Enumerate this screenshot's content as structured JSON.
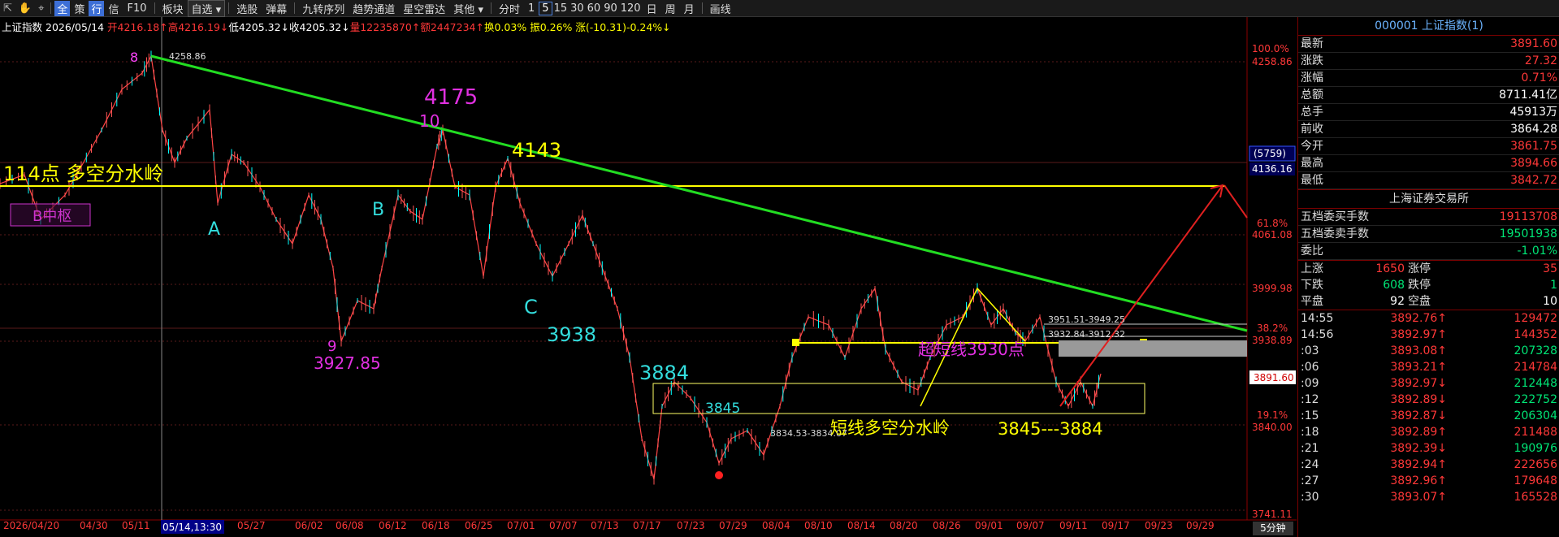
{
  "toolbar": {
    "icons": [
      "arrow-icon",
      "hand-icon"
    ],
    "quick": [
      "全",
      "策",
      "行",
      "信",
      "F10"
    ],
    "menu": [
      "板块",
      "自选",
      "选股",
      "弹幕",
      "九转序列",
      "趋势通道",
      "星空雷达",
      "其他"
    ],
    "periods": [
      "分时",
      "1",
      "5",
      "15",
      "30",
      "60",
      "90",
      "120",
      "日",
      "周",
      "月"
    ],
    "active_period": "5",
    "draw": "画线"
  },
  "info": {
    "name": "上证指数",
    "date": "2026/05/14",
    "open": "开4216.18↑",
    "high": "高4216.19↓",
    "low": "低4205.32↓",
    "close": "收4205.32↓",
    "vol": "量12235870↑",
    "amt": "额2447234↑",
    "turnover": "换0.03%",
    "amp": "振0.26%",
    "chg": "涨(-10.31)-0.24%↓"
  },
  "chart_annotations": {
    "wave8": "8",
    "wave9": "9",
    "wave10": "10",
    "waveA": "A",
    "waveB": "B",
    "waveC": "C",
    "n4175": "4175",
    "n4143": "4143",
    "n3938": "3938",
    "n3884": "3884",
    "n3845": "3845",
    "n3927": "3927.85",
    "peak": "4258.86",
    "divide_left": "114点  多空分水岭",
    "zone_box": "B中枢",
    "short_line": "短线多空分水岭",
    "super_short": "超短线3930点",
    "range": "3845---3884",
    "ann1": "3951.51-3949.25",
    "ann2": "3932.84-3912.32",
    "ann3": "3834.53-3834.07"
  },
  "axis": {
    "right_levels": [
      "100.0%",
      "4258.86",
      "4136.16",
      "61.8%",
      "4061.08",
      "3999.98",
      "38.2%",
      "3938.89",
      "3891.60",
      "19.1%",
      "3840.00",
      "3741.11"
    ],
    "badge": "(5759)",
    "x_dates": [
      "2026/04/20",
      "04/30",
      "05/11",
      "05/14,13:30",
      "05/27",
      "06/02",
      "06/08",
      "06/12",
      "06/18",
      "06/25",
      "07/01",
      "07/07",
      "07/13",
      "07/17",
      "07/23",
      "07/29",
      "08/04",
      "08/10",
      "08/14",
      "08/20",
      "08/26",
      "09/01",
      "09/07",
      "09/11",
      "09/17",
      "09/23",
      "09/29"
    ],
    "period": "5分钟"
  },
  "panel": {
    "title": "000001 上证指数(1)",
    "rows": [
      {
        "label": "最新",
        "value": "3891.60",
        "color": "red"
      },
      {
        "label": "涨跌",
        "value": "27.32",
        "color": "red"
      },
      {
        "label": "涨幅",
        "value": "0.71%",
        "color": "red"
      },
      {
        "label": "总额",
        "value": "8711.41亿",
        "color": "white"
      },
      {
        "label": "总手",
        "value": "45913万",
        "color": "white"
      },
      {
        "label": "前收",
        "value": "3864.28",
        "color": "white"
      },
      {
        "label": "今开",
        "value": "3861.75",
        "color": "red"
      },
      {
        "label": "最高",
        "value": "3894.66",
        "color": "red"
      },
      {
        "label": "最低",
        "value": "3842.72",
        "color": "red"
      }
    ],
    "exchange": "上海证券交易所",
    "rows2": [
      {
        "label": "五档委买手数",
        "value": "19113708",
        "color": "red"
      },
      {
        "label": "五档委卖手数",
        "value": "19501938",
        "color": "green"
      },
      {
        "label": "委比",
        "value": "-1.01%",
        "color": "green"
      }
    ],
    "rows3": [
      {
        "a": "上涨",
        "b": "1650",
        "c": "涨停",
        "d": "35",
        "bc": "red",
        "dc": "red"
      },
      {
        "a": "下跌",
        "b": "608",
        "c": "跌停",
        "d": "1",
        "bc": "green",
        "dc": "green"
      },
      {
        "a": "平盘",
        "b": "92",
        "c": "空盘",
        "d": "10",
        "bc": "white",
        "dc": "white"
      }
    ],
    "ticks": [
      {
        "t": "14:55",
        "p": "3892.76↑",
        "v": "129472",
        "g": false
      },
      {
        "t": "14:56",
        "p": "3892.97↑",
        "v": "144352",
        "g": false
      },
      {
        "t": ":03",
        "p": "3893.08↑",
        "v": "207328",
        "g": true
      },
      {
        "t": ":06",
        "p": "3893.21↑",
        "v": "214784",
        "g": false
      },
      {
        "t": ":09",
        "p": "3892.97↓",
        "v": "212448",
        "g": true
      },
      {
        "t": ":12",
        "p": "3892.89↓",
        "v": "222752",
        "g": true
      },
      {
        "t": ":15",
        "p": "3892.87↓",
        "v": "206304",
        "g": true
      },
      {
        "t": ":18",
        "p": "3892.89↑",
        "v": "211488",
        "g": false
      },
      {
        "t": ":21",
        "p": "3892.39↓",
        "v": "190976",
        "g": true
      },
      {
        "t": ":24",
        "p": "3892.94↑",
        "v": "222656",
        "g": false
      },
      {
        "t": ":27",
        "p": "3892.96↑",
        "v": "179648",
        "g": false
      },
      {
        "t": ":30",
        "p": "3893.07↑",
        "v": "165528",
        "g": false
      }
    ]
  }
}
